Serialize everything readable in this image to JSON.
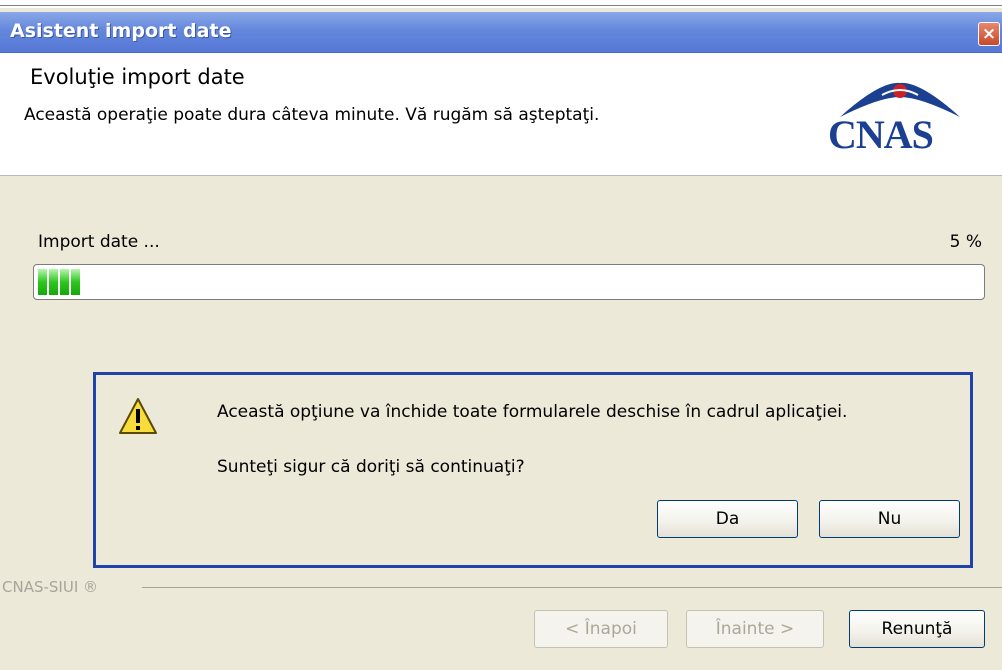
{
  "window": {
    "title": "Asistent import date",
    "close_label": "×"
  },
  "header": {
    "title": "Evoluţie import date",
    "subtitle": "Această operaţie poate dura câteva minute. Vă rugăm să aşteptaţi.",
    "logo_text": "CNAS"
  },
  "progress": {
    "label": "Import date ...",
    "percent_text": "5 %",
    "value": 0.05,
    "fill_color": "#2ec61f"
  },
  "dialog": {
    "icon": "warning-icon",
    "message": "Această opţiune va închide toate formularele deschise în cadrul aplicaţiei.",
    "question": "Sunteţi sigur că doriţi să continuaţi?",
    "yes_label": "Da",
    "no_label": "Nu",
    "border_color": "#1f43a8"
  },
  "footer": {
    "brand": "CNAS-SIUI ®",
    "back_label": "< Înapoi",
    "next_label": "Înainte >",
    "cancel_label": "Renunţă"
  }
}
